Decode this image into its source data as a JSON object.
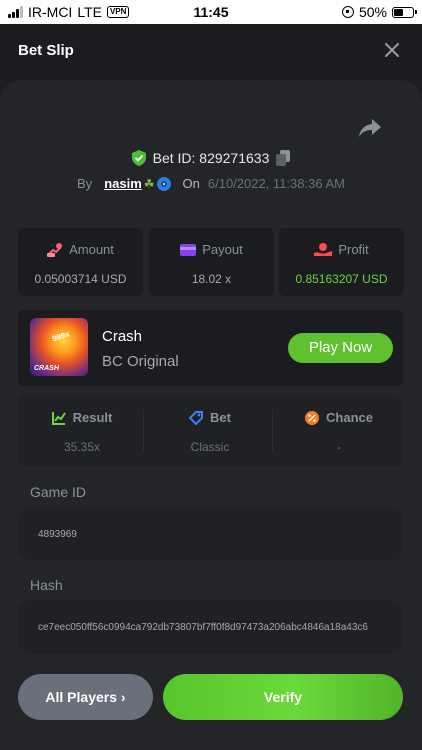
{
  "status_bar": {
    "carrier": "IR-MCI",
    "network": "LTE",
    "vpn": "VPN",
    "time": "11:45",
    "battery": "50%"
  },
  "header": {
    "title": "Bet Slip"
  },
  "bet": {
    "bet_id": "Bet ID: 829271633",
    "by_label": "By",
    "user": "nasim",
    "on_label": "On",
    "date": "6/10/2022, 11:38:36 AM"
  },
  "stats": [
    {
      "label": "Amount",
      "value": "0.05003714 USD",
      "icon": "coins-icon",
      "color": "#ff5c7a"
    },
    {
      "label": "Payout",
      "value": "18.02 x",
      "icon": "wallet-icon",
      "color": "#8a3cf7"
    },
    {
      "label": "Profit",
      "value": "0.85163207 USD",
      "icon": "profit-hand-icon",
      "color": "#ff4a4a"
    }
  ],
  "game": {
    "name": "Crash",
    "subtitle": "BC Original",
    "thumb_badge": "999x",
    "thumb_label": "CRASH",
    "play_label": "Play Now"
  },
  "info": [
    {
      "label": "Result",
      "value": "35.35x",
      "icon": "chart-icon",
      "color": "#6fd43f"
    },
    {
      "label": "Bet",
      "value": "Classic",
      "icon": "tag-icon",
      "color": "#3b82f6"
    },
    {
      "label": "Chance",
      "value": "-",
      "icon": "percent-icon",
      "color": "#f47c20"
    }
  ],
  "fields": {
    "game_id_label": "Game ID",
    "game_id_value": "4893969",
    "hash_label": "Hash",
    "hash_value": "ce7eec050ff56c0994ca792db73807bf7ff0f8d97473a206abc4846a18a43c6"
  },
  "actions": {
    "all_players": "All Players",
    "verify": "Verify"
  }
}
